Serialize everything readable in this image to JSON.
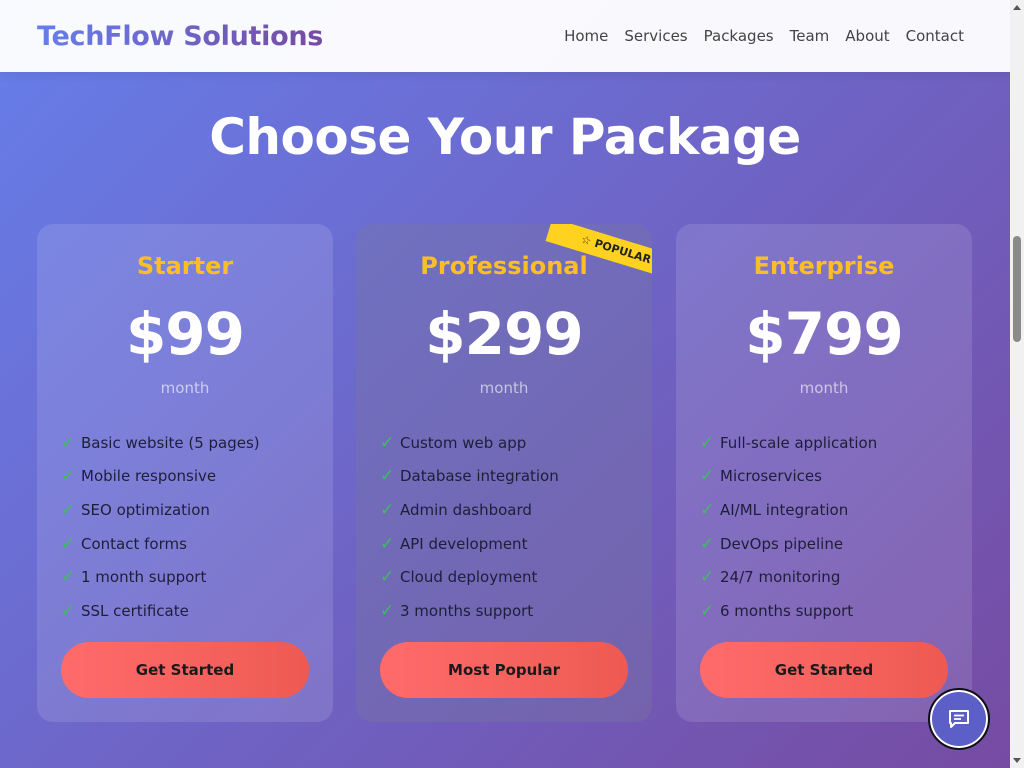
{
  "header": {
    "brand": "TechFlow Solutions",
    "nav": [
      "Home",
      "Services",
      "Packages",
      "Team",
      "About",
      "Contact"
    ]
  },
  "main": {
    "title": "Choose Your Package"
  },
  "plans": [
    {
      "name": "Starter",
      "price": "$99",
      "period": "month",
      "features": [
        "Basic website (5 pages)",
        "Mobile responsive",
        "SEO optimization",
        "Contact forms",
        "1 month support",
        "SSL certificate"
      ],
      "cta": "Get Started"
    },
    {
      "name": "Professional",
      "price": "$299",
      "period": "month",
      "badge": "POPULAR",
      "features": [
        "Custom web app",
        "Database integration",
        "Admin dashboard",
        "API development",
        "Cloud deployment",
        "3 months support"
      ],
      "cta": "Most Popular"
    },
    {
      "name": "Enterprise",
      "price": "$799",
      "period": "month",
      "features": [
        "Full-scale application",
        "Microservices",
        "AI/ML integration",
        "DevOps pipeline",
        "24/7 monitoring",
        "6 months support"
      ],
      "cta": "Get Started"
    }
  ],
  "icons": {
    "check": "check-icon",
    "star": "star-icon",
    "chat": "chat-icon"
  },
  "colors": {
    "gradient_start": "#667eea",
    "gradient_end": "#764ba2",
    "plan_name": "#fbbf24",
    "cta_start": "#ff6b6b",
    "cta_end": "#ee5a52",
    "check": "#3bbf5a",
    "badge": "#ffd21f"
  }
}
